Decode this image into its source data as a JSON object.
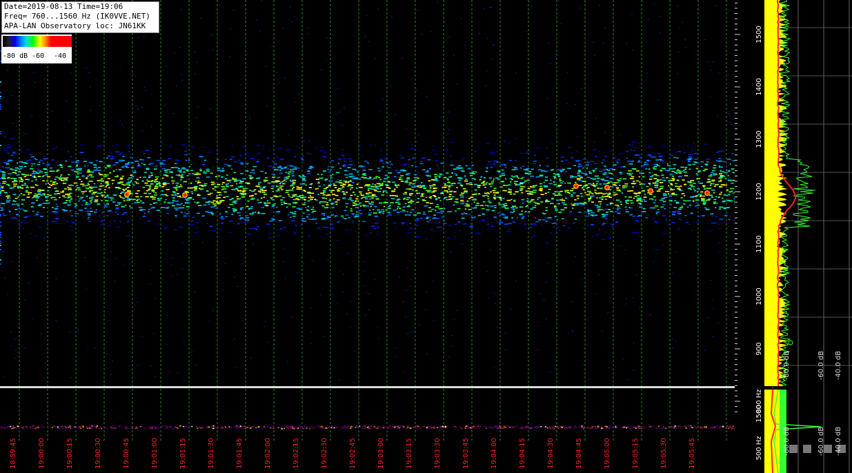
{
  "header": {
    "line1": "Date=2019-08-13 Time=19:06",
    "line2": "Freq= 760...1560 Hz (IK0VVE.NET)",
    "line3": "APA-LAN Observatory loc: JN61KK"
  },
  "legend": {
    "labels": [
      "-80 dB",
      "-60",
      "-40"
    ]
  },
  "freq_axis": {
    "labels": [
      "1500",
      "1400",
      "1300",
      "1200",
      "1100",
      "1000",
      "900",
      "800 Hz"
    ],
    "values": [
      1500,
      1400,
      1300,
      1200,
      1100,
      1000,
      900,
      800
    ]
  },
  "bottom_freq_axis": {
    "labels": [
      "1500",
      "500 Hz"
    ]
  },
  "spectrum_axis": {
    "labels": [
      "-80.0 dB",
      "-60.0 dB",
      "-40.0 dB"
    ]
  },
  "time_axis": {
    "labels": [
      "18:59:45",
      "19:00:00",
      "19:00:15",
      "19:00:30",
      "19:00:45",
      "19:01:00",
      "19:01:15",
      "19:01:30",
      "19:01:45",
      "19:02:00",
      "19:02:15",
      "19:02:30",
      "19:02:45",
      "19:03:00",
      "19:03:15",
      "19:03:30",
      "19:03:45",
      "19:04:00",
      "19:04:15",
      "19:04:30",
      "19:04:45",
      "19:05:00",
      "19:05:15",
      "19:05:30",
      "19:05:45"
    ]
  },
  "colors": {
    "time_label": "#ff2020",
    "gridline": "#2a8a2a",
    "spectrum_yellow": "#ffff00",
    "spectrum_green": "#33ff33",
    "spectrum_red": "#ff2020"
  }
}
